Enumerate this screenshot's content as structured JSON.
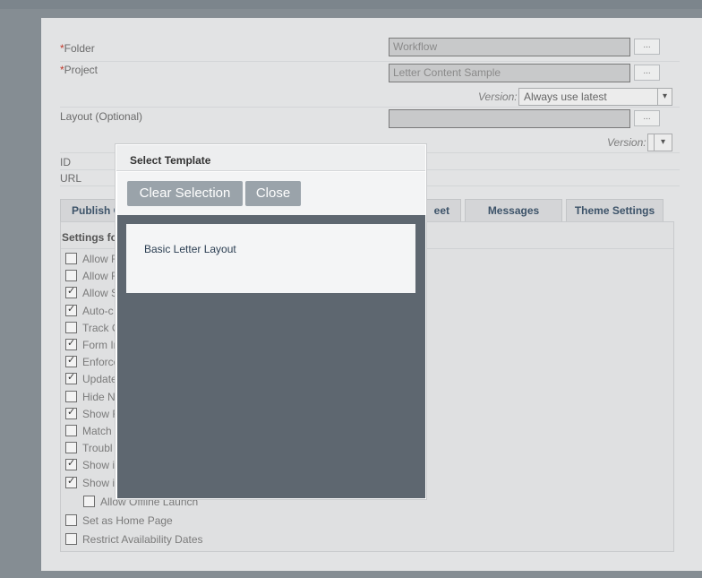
{
  "form": {
    "folder": {
      "required_mark": "*",
      "label": "Folder",
      "value": "Workflow",
      "browse": "..."
    },
    "project": {
      "required_mark": "*",
      "label": "Project",
      "value": "Letter Content Sample",
      "browse": "..."
    },
    "project_version": {
      "label": "Version:",
      "value": "Always use latest"
    },
    "layout": {
      "label": "Layout (Optional)",
      "value": "",
      "browse": "..."
    },
    "layout_version": {
      "label": "Version:",
      "value": ""
    },
    "id_label": "ID",
    "url_label": "URL"
  },
  "tabs": [
    {
      "label": "Publish O"
    },
    {
      "label": "eet"
    },
    {
      "label": "Messages"
    },
    {
      "label": "Theme Settings"
    }
  ],
  "settings": {
    "title": "Settings fo",
    "items": [
      {
        "label": "Allow F",
        "checked": false
      },
      {
        "label": "Allow F",
        "checked": false
      },
      {
        "label": "Allow S",
        "checked": true
      },
      {
        "label": "Auto-c",
        "checked": true
      },
      {
        "label": "Track C",
        "checked": false
      },
      {
        "label": "Form In",
        "checked": true
      },
      {
        "label": "Enforce",
        "checked": true
      },
      {
        "label": "Update",
        "checked": true
      },
      {
        "label": "Hide N",
        "checked": false
      },
      {
        "label": "Show F",
        "checked": true
      },
      {
        "label": "Match",
        "checked": false
      },
      {
        "label": "Troubl",
        "checked": false
      },
      {
        "label": "Show i",
        "checked": true
      },
      {
        "label": "Show i",
        "checked": true
      },
      {
        "label": "Allow Offline Launch",
        "checked": false
      },
      {
        "label": "Set as Home Page",
        "checked": false
      },
      {
        "label": "Restrict Availability Dates",
        "checked": false
      }
    ]
  },
  "modal": {
    "title": "Select Template",
    "clear_button": "Clear Selection",
    "close_button": "Close",
    "templates": [
      {
        "name": "Basic Letter Layout"
      }
    ]
  },
  "colors": {
    "backdrop": "#858d93",
    "panel": "#e2e3e4",
    "modal_body": "#5e6770",
    "modal_button": "#9aa3aa",
    "tab_text": "#3d5369"
  }
}
